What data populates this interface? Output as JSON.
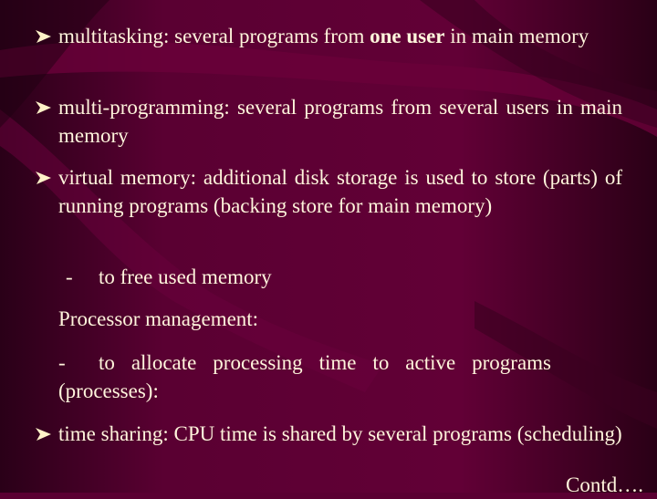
{
  "bullets": [
    {
      "before": "multitasking: several programs from ",
      "bold1": "one",
      "space": " ",
      "bold2": "user",
      "after": " in main memory"
    },
    {
      "text": "multi-programming: several programs from several users in main memory"
    },
    {
      "text": "virtual memory: additional disk storage is used to store (parts) of running programs (backing store for main memory)"
    }
  ],
  "sub1": {
    "dash": "-",
    "text": "to free used memory"
  },
  "section": "Processor management:",
  "sub2": {
    "dash": "-",
    "text": "to allocate processing time to active programs (processes):"
  },
  "bullet4": {
    "text": "time sharing: CPU time is shared by several programs (scheduling)"
  },
  "footer": "Contd….",
  "colors": {
    "background": "#5a0032",
    "text": "#fff5dc",
    "bullet": "#fff2c8"
  },
  "icons": {
    "bullet": "arrowhead-bullet-icon"
  }
}
